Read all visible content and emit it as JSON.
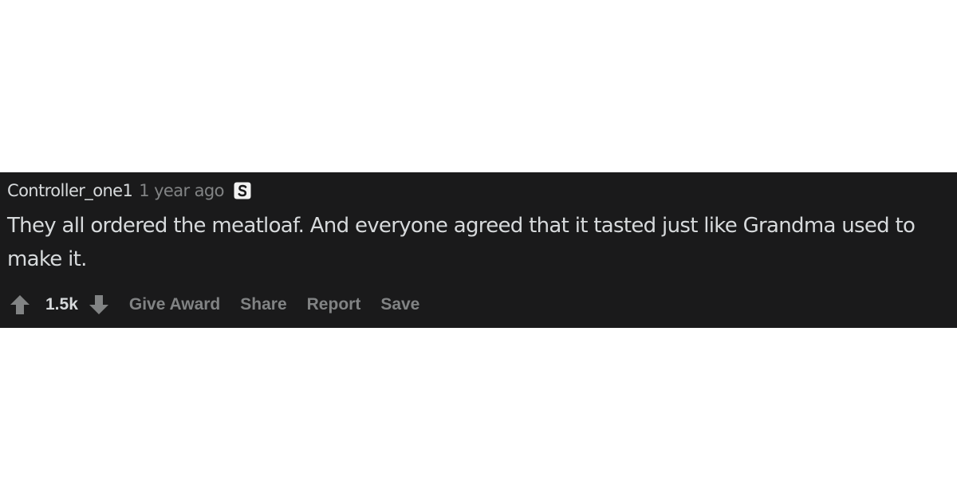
{
  "comment": {
    "author": "Controller_one1",
    "timestamp": "1 year ago",
    "badge_icon": "s-badge-icon",
    "body": "They all ordered the meatloaf. And everyone agreed that it tasted just like Grandma used to make it.",
    "score": "1.5k",
    "actions": {
      "give_award": "Give Award",
      "share": "Share",
      "report": "Report",
      "save": "Save"
    },
    "icons": {
      "upvote": "upvote-arrow-icon",
      "downvote": "downvote-arrow-icon"
    },
    "colors": {
      "background": "#1a1a1b",
      "primary_text": "#d7dadc",
      "muted_text": "#818384"
    }
  }
}
